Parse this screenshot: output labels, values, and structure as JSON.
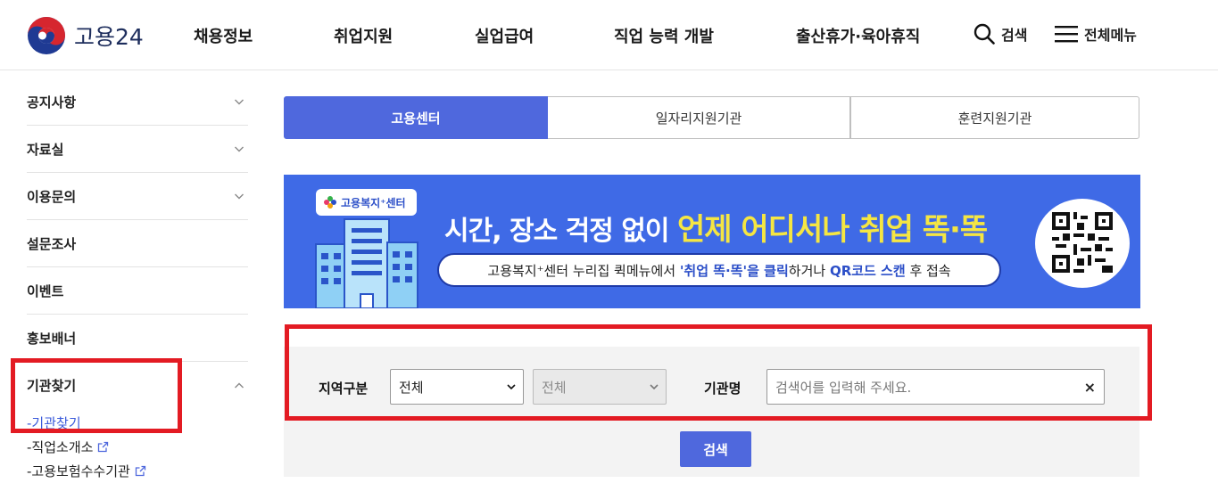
{
  "header": {
    "logo_text": "고용24",
    "nav": [
      "채용정보",
      "취업지원",
      "실업급여",
      "직업 능력 개발",
      "출산휴가·육아휴직"
    ],
    "search_label": "검색",
    "menu_label": "전체메뉴"
  },
  "sidebar": {
    "items": [
      {
        "label": "공지사항"
      },
      {
        "label": "자료실"
      },
      {
        "label": "이용문의"
      },
      {
        "label": "설문조사"
      },
      {
        "label": "이벤트"
      },
      {
        "label": "홍보배너"
      },
      {
        "label": "기관찾기"
      }
    ],
    "sub_items": [
      {
        "label": "-기관찾기"
      },
      {
        "label": "-직업소개소"
      },
      {
        "label": "-고용보험수수기관"
      }
    ]
  },
  "tabs": [
    "고용센터",
    "일자리지원기관",
    "훈련지원기관"
  ],
  "banner": {
    "badge": "고용복지⁺센터",
    "headline_lead": "시간, 장소 걱정 없이",
    "headline_highlight": "언제 어디서나 취업 똑·똑",
    "pill_a": "고용복지⁺센터 누리집 퀵메뉴에서 ",
    "pill_b": "'취업 똑·똑'을 클릭",
    "pill_c": "하거나 ",
    "pill_d": "QR코드 스캔",
    "pill_e": " 후 접속"
  },
  "search": {
    "region_label": "지역구분",
    "region_value": "전체",
    "subregion_value": "전체",
    "org_label": "기관명",
    "org_placeholder": "검색어를 입력해 주세요.",
    "clear": "×",
    "submit": "검색"
  },
  "colors": {
    "accent": "#4f68dd",
    "banner_bg": "#3f6ae6",
    "highlight": "#e31b23",
    "banner_yellow": "#f5e642"
  }
}
